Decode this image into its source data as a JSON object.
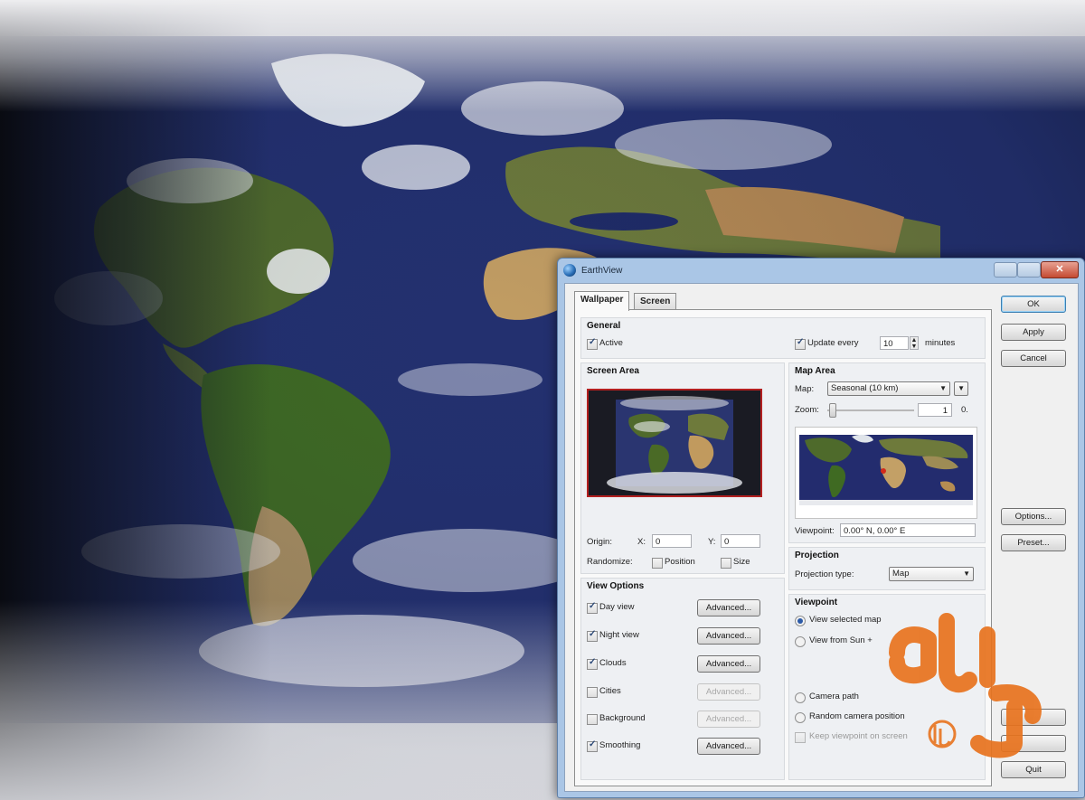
{
  "window": {
    "title": "EarthView"
  },
  "tabs": [
    {
      "label": "Wallpaper",
      "active": true
    },
    {
      "label": "Screen Saver",
      "active": false
    }
  ],
  "general": {
    "title": "General",
    "active_label": "Active",
    "active_checked": true,
    "update_label": "Update every",
    "update_checked": true,
    "update_value": "10",
    "update_units": "minutes"
  },
  "screen_area": {
    "title": "Screen Area",
    "origin_label": "Origin:",
    "x_label": "X:",
    "x_value": "0",
    "y_label": "Y:",
    "y_value": "0",
    "randomize_label": "Randomize:",
    "position_label": "Position",
    "size_label": "Size"
  },
  "map_area": {
    "title": "Map Area",
    "map_label": "Map:",
    "map_value": "Seasonal (10 km)",
    "zoom_label": "Zoom:",
    "zoom_value": "1",
    "zoom_suffix": "0.",
    "viewpoint_label": "Viewpoint:",
    "viewpoint_value": "0.00° N, 0.00° E"
  },
  "projection": {
    "title": "Projection",
    "type_label": "Projection type:",
    "type_value": "Map"
  },
  "view_options": {
    "title": "View Options",
    "items": [
      {
        "label": "Day view",
        "checked": true,
        "button": "Advanced...",
        "enabled": true
      },
      {
        "label": "Night view",
        "checked": true,
        "button": "Advanced...",
        "enabled": true
      },
      {
        "label": "Clouds",
        "checked": true,
        "button": "Advanced...",
        "enabled": true
      },
      {
        "label": "Cities",
        "checked": false,
        "button": "Advanced...",
        "enabled": false
      },
      {
        "label": "Background",
        "checked": false,
        "button": "Advanced...",
        "enabled": false
      },
      {
        "label": "Smoothing",
        "checked": true,
        "button": "Advanced...",
        "enabled": true
      }
    ]
  },
  "viewpoint": {
    "title": "Viewpoint",
    "options": [
      {
        "label": "View selected map",
        "selected": true
      },
      {
        "label": "View from Sun +",
        "selected": false
      },
      {
        "label": "Camera path",
        "selected": false
      },
      {
        "label": "Random camera position",
        "selected": false
      }
    ],
    "keep_label": "Keep viewpoint on screen"
  },
  "buttons": {
    "ok": "OK",
    "apply": "Apply",
    "cancel": "Cancel",
    "options": "Options...",
    "preset": "Preset...",
    "quit": "Quit"
  },
  "colors": {
    "dialog_frame": "#aac6e6",
    "preview_border": "#b32020",
    "watermark": "#e8731e"
  },
  "icons": [
    "earthview-app-icon",
    "close-icon",
    "minimize-icon",
    "maximize-icon",
    "chevron-down-icon"
  ]
}
